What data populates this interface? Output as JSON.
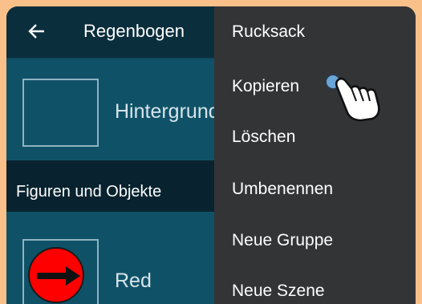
{
  "header": {
    "title": "Regenbogen",
    "back_icon": "back-arrow-icon"
  },
  "list": {
    "background_label": "Hintergrund",
    "section_title": "Figuren und Objekte",
    "objects": [
      {
        "label": "Red"
      }
    ]
  },
  "menu": {
    "items": [
      {
        "label": "Rucksack"
      },
      {
        "label": "Kopieren"
      },
      {
        "label": "Löschen"
      },
      {
        "label": "Umbenennen"
      },
      {
        "label": "Neue Gruppe"
      },
      {
        "label": "Neue Szene"
      }
    ]
  },
  "colors": {
    "outer_background": "#f9c189",
    "appbar": "#0b2e3d",
    "list_background": "#0f5268",
    "menu_background": "#333436",
    "object_circle": "#ff0000"
  },
  "cursor_icon": "hand-pointer-icon"
}
